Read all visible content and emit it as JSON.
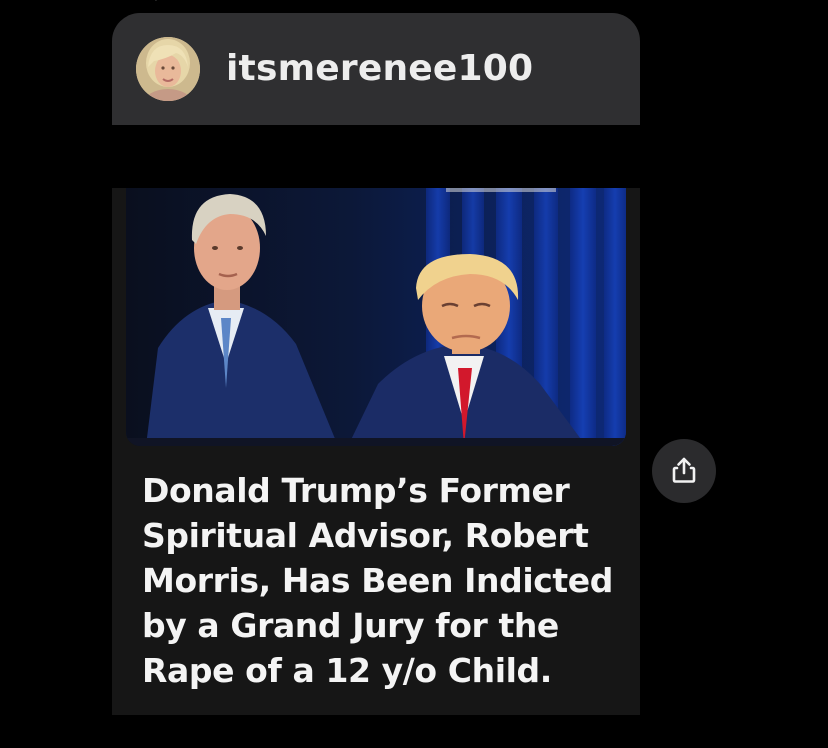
{
  "post": {
    "author": {
      "username": "itsmerenee100",
      "avatar_icon": "profile-photo"
    },
    "image": {
      "description_icon": "news-photo"
    },
    "headline": "Donald Trump’s Former\nSpiritual Advisor, Robert\nMorris, Has Been Indicted\nby a Grand Jury for the\nRape of a 12 y/o Child."
  },
  "actions": {
    "share_icon": "share-icon"
  },
  "colors": {
    "background": "#000000",
    "header_card": "#2f2f31",
    "post_card": "#161616",
    "text_primary": "#f4f4f4",
    "share_button": "#2b2b2d"
  }
}
